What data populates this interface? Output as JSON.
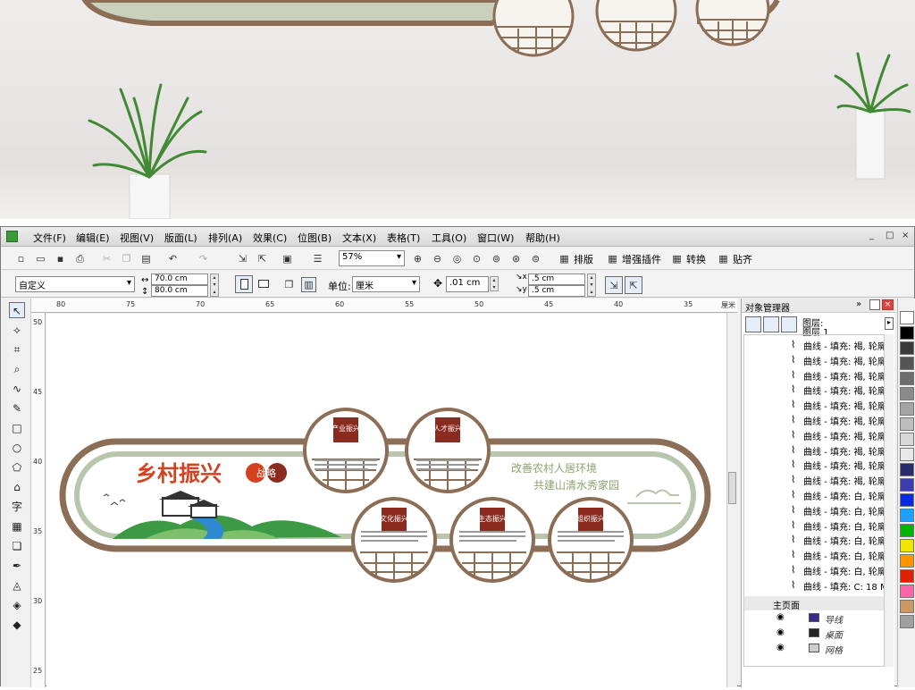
{
  "app": {
    "menu": [
      "文件(F)",
      "编辑(E)",
      "视图(V)",
      "版面(L)",
      "排列(A)",
      "效果(C)",
      "位图(B)",
      "文本(X)",
      "表格(T)",
      "工具(O)",
      "窗口(W)",
      "帮助(H)"
    ],
    "window_controls": [
      "_",
      "□",
      "×"
    ]
  },
  "toolbar1": {
    "zoom": "57%",
    "buttons": [
      "排版",
      "增强插件",
      "转换",
      "贴齐"
    ]
  },
  "toolbar2": {
    "page_size": "自定义",
    "width": "70.0 cm",
    "height": "80.0 cm",
    "unit_label": "单位:",
    "unit_value": "厘米",
    "nudge": ".01 cm",
    "dup_x": ".5 cm",
    "dup_y": ".5 cm"
  },
  "rulers": {
    "horizontal": [
      "80",
      "75",
      "70",
      "65",
      "60",
      "55",
      "50",
      "45",
      "40",
      "35"
    ],
    "h_unit": "厘米",
    "vertical": [
      "50",
      "45",
      "40",
      "35",
      "30",
      "25"
    ]
  },
  "design": {
    "title": "乡村振兴",
    "title_badge": "战略",
    "slogan_1": "改善农村人居环境",
    "slogan_2": "共建山清水秀家园",
    "circles": [
      {
        "label": "产业振兴"
      },
      {
        "label": "人才振兴"
      },
      {
        "label": "文化振兴"
      },
      {
        "label": "生态振兴"
      },
      {
        "label": "组织振兴"
      }
    ]
  },
  "docker": {
    "title": "对象管理器",
    "layer_label": "图层:",
    "layer_name": "图层 1",
    "objects": [
      "曲线 - 填充: 褐, 轮廓",
      "曲线 - 填充: 褐, 轮廓",
      "曲线 - 填充: 褐, 轮廓",
      "曲线 - 填充: 褐, 轮廓",
      "曲线 - 填充: 褐, 轮廓",
      "曲线 - 填充: 褐, 轮廓",
      "曲线 - 填充: 褐, 轮廓",
      "曲线 - 填充: 褐, 轮廓",
      "曲线 - 填充: 褐, 轮廓",
      "曲线 - 填充: 褐, 轮廓",
      "曲线 - 填充: 白, 轮廓",
      "曲线 - 填充: 白, 轮廓",
      "曲线 - 填充: 白, 轮廓",
      "曲线 - 填充: 白, 轮廓",
      "曲线 - 填充: 白, 轮廓",
      "曲线 - 填充: 白, 轮廓",
      "曲线 - 填充: C: 18 M"
    ],
    "master_page": "主页面",
    "master_layers": [
      "导线",
      "桌面",
      "网格"
    ]
  },
  "palette": [
    "#ffffff",
    "#000000",
    "#3a3a3a",
    "#555555",
    "#6e6e6e",
    "#8a8a8a",
    "#a4a4a4",
    "#bebebe",
    "#d8d8d8",
    "#e8e8e8",
    "#2a2a6e",
    "#3d3db0",
    "#0a2ae0",
    "#1ea0ff",
    "#00b400",
    "#f0e600",
    "#ff9600",
    "#e02000",
    "#ff66aa",
    "#cc9966",
    "#a0a0a0"
  ],
  "colors": {
    "brand_red": "#d2421f",
    "frame_brown": "#8b6e55",
    "frame_green": "#b8c6ad"
  }
}
